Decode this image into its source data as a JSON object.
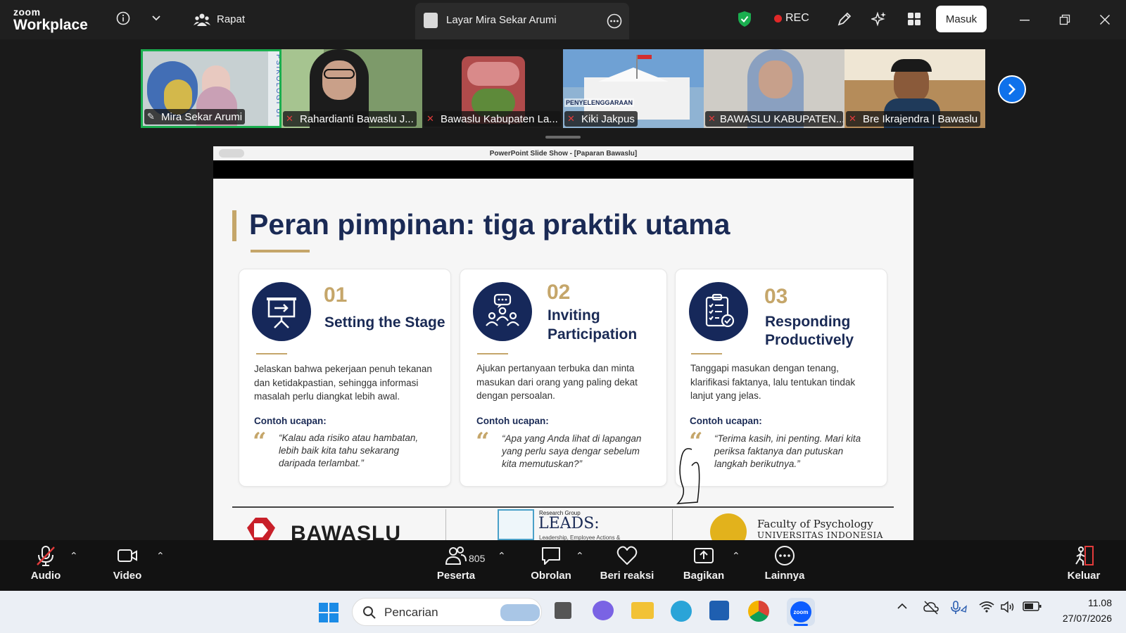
{
  "app": {
    "logo_small": "zoom",
    "logo_big": "Workplace",
    "meeting_label": "Rapat",
    "share_tab_label": "Layar Mira Sekar Arumi",
    "rec_label": "REC",
    "signin_label": "Masuk"
  },
  "gallery": [
    {
      "name": "Mira Sekar Arumi",
      "muted": false,
      "speaking": true,
      "bg": "#b9c6c8"
    },
    {
      "name": "Rahardianti Bawaslu J...",
      "muted": true,
      "bg": "#6e8d5d"
    },
    {
      "name": "Bawaslu Kabupaten La...",
      "muted": true,
      "bg": "#1d1d1d"
    },
    {
      "name": "Kiki Jakpus",
      "muted": true,
      "bg": "#8fb3d3"
    },
    {
      "name": "BAWASLU KABUPATEN...",
      "muted": true,
      "bg": "#c9c6c0"
    },
    {
      "name": "Bre Ikrajendra | Bawaslu",
      "muted": true,
      "bg": "#b38a57"
    }
  ],
  "tile_texts": {
    "psikologi": "PSIKOLOGI UI",
    "penyelenggaraan": "PENYELENGGARAAN"
  },
  "slide": {
    "window_title": "PowerPoint Slide Show - [Paparan Bawaslu]",
    "title": "Peran pimpinan: tiga praktik utama",
    "example_label": "Contoh ucapan:",
    "cards": [
      {
        "num": "01",
        "heading_lines": [
          "Setting the Stage"
        ],
        "body": "Jelaskan bahwa pekerjaan penuh tekanan dan ketidakpastian, sehingga informasi masalah perlu diangkat lebih awal.",
        "quote": "“Kalau ada risiko atau hambatan, lebih baik kita tahu sekarang daripada terlambat.”",
        "icon": "presentation-board-icon"
      },
      {
        "num": "02",
        "heading_lines": [
          "Inviting",
          "Participation"
        ],
        "body": "Ajukan pertanyaan terbuka dan minta masukan dari orang yang paling dekat dengan persoalan.",
        "quote": "“Apa yang Anda lihat di lapangan yang perlu saya dengar sebelum kita memutuskan?”",
        "icon": "group-discussion-icon"
      },
      {
        "num": "03",
        "heading_lines": [
          "Responding",
          "Productively"
        ],
        "body": "Tanggapi masukan dengan tenang, klarifikasi faktanya, lalu tentukan tindak lanjut yang jelas.",
        "quote": "“Terima kasih, ini penting. Mari kita periksa faktanya dan putuskan langkah berikutnya.”",
        "icon": "checklist-icon"
      }
    ],
    "footer": {
      "bawaslu": "BAWASLU",
      "leads_small": "Research Group",
      "leads_big": "LEADS:",
      "leads_sub": "Leadership, Employee Actions &",
      "faculty_line1": "Faculty of Psychology",
      "faculty_line2": "UNIVERSITAS INDONESIA"
    }
  },
  "controls": {
    "audio": "Audio",
    "video": "Video",
    "participants": "Peserta",
    "participant_count": "805",
    "chat": "Obrolan",
    "react": "Beri reaksi",
    "share": "Bagikan",
    "more": "Lainnya",
    "leave": "Keluar"
  },
  "taskbar": {
    "search_placeholder": "Pencarian",
    "time": "11.08",
    "date": "27/07/2026"
  },
  "colors": {
    "accent_blue": "#0e71eb",
    "gold": "#c5a66a",
    "navy": "#16285a",
    "rec_red": "#e02828",
    "shield_green": "#1aae4f"
  }
}
